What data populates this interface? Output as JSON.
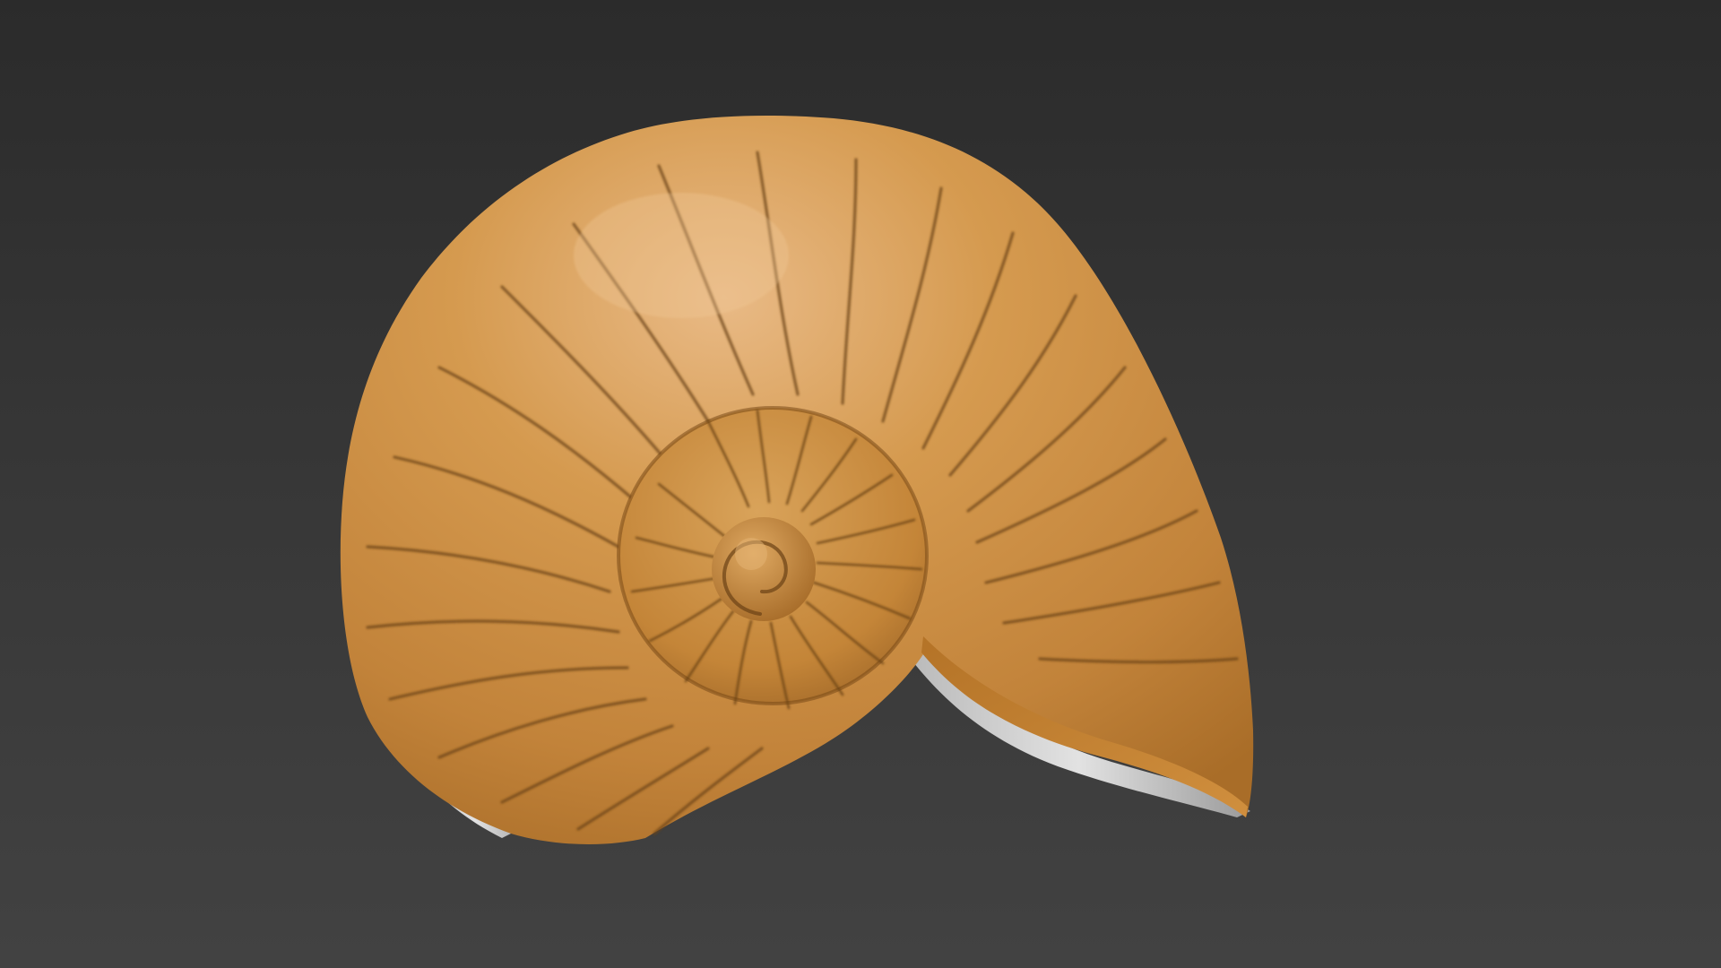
{
  "viewport": {
    "background_top": "#2b2b2b",
    "background_bottom": "#424242"
  },
  "model": {
    "subject": "nautilus-shell-icon",
    "shell_color": "#c98b3a",
    "highlight_color": "#e7b680",
    "shadow_color": "#8a5a1f",
    "groove_color": "#6b4216",
    "interior_color": "#cfcfcf"
  }
}
